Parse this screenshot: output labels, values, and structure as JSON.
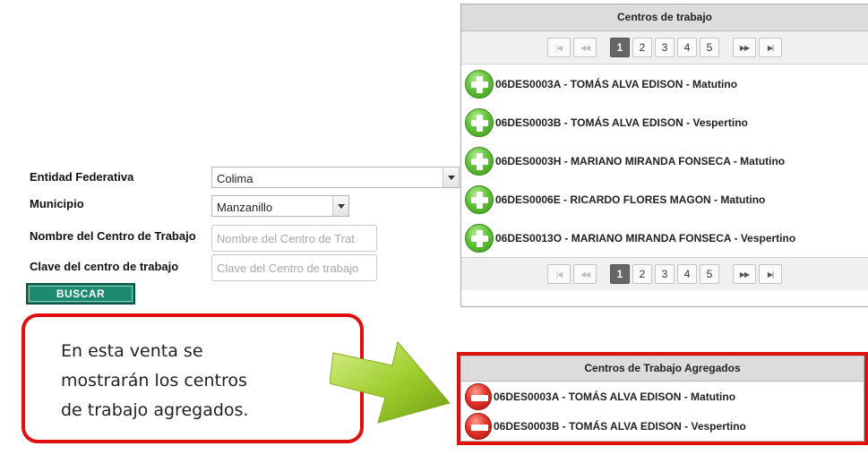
{
  "form": {
    "entidad_label": "Entidad Federativa",
    "entidad_value": "Colima",
    "municipio_label": "Municipio",
    "municipio_value": "Manzanillo",
    "nombre_label": "Nombre del Centro de Trabajo",
    "nombre_placeholder": "Nombre del Centro de Trat",
    "clave_label": "Clave del centro de trabajo",
    "clave_placeholder": "Clave del Centro de trabajo",
    "buscar_label": "BUSCAR"
  },
  "centros": {
    "title": "Centros de trabajo",
    "pager": {
      "first_glyph": "|◀",
      "prev_glyph": "◀◀",
      "next_glyph": "▶▶",
      "last_glyph": "▶|",
      "pages": [
        "1",
        "2",
        "3",
        "4",
        "5"
      ],
      "current": "1"
    },
    "items": [
      "06DES0003A - TOMÁS ALVA EDISON - Matutino",
      "06DES0003B - TOMÁS ALVA EDISON - Vespertino",
      "06DES0003H - MARIANO MIRANDA FONSECA - Matutino",
      "06DES0006E - RICARDO FLORES MAGON - Matutino",
      "06DES0013O - MARIANO MIRANDA FONSECA - Vespertino"
    ],
    "item_icon": "add-circle-icon"
  },
  "agregados": {
    "title": "Centros de Trabajo Agregados",
    "items": [
      "06DES0003A - TOMÁS ALVA EDISON - Matutino",
      "06DES0003B - TOMÁS ALVA EDISON - Vespertino"
    ],
    "item_icon": "remove-circle-icon"
  },
  "callout": {
    "text": "En esta venta se mostrarán los centros de trabajo agregados.",
    "border_color": "#e0100f"
  },
  "colors": {
    "button_bg": "#1e8a70",
    "add_green": "#60c236",
    "remove_red": "#e2342a",
    "arrow_green": "#9ccc2a"
  }
}
